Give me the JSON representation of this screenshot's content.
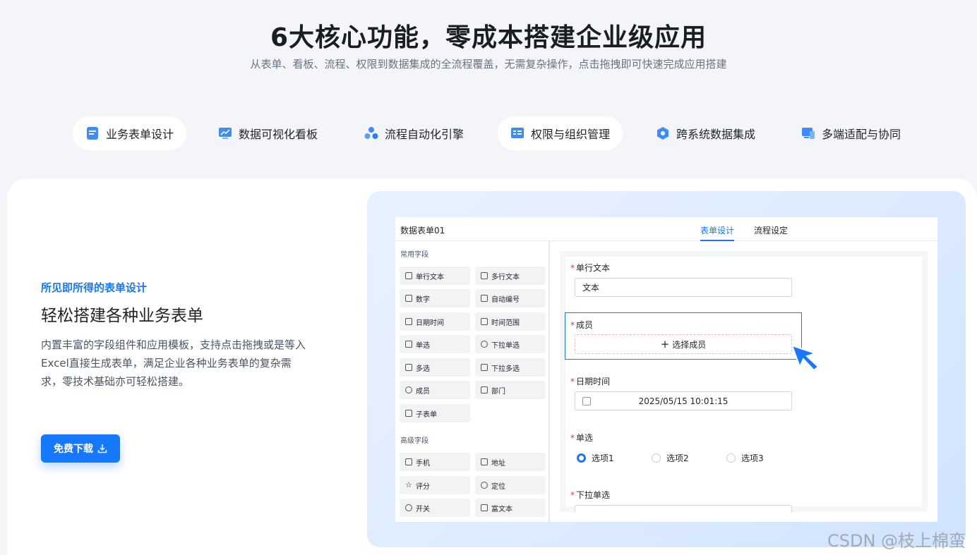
{
  "hero": {
    "title": "6大核心功能，零成本搭建企业级应用",
    "subtitle": "从表单、看板、流程、权限到数据集成的全流程覆盖，无需复杂操作，点击拖拽即可快速完成应用搭建"
  },
  "tabs": [
    {
      "label": "业务表单设计",
      "icon": "form-icon"
    },
    {
      "label": "数据可视化看板",
      "icon": "chart-icon"
    },
    {
      "label": "流程自动化引擎",
      "icon": "flow-icon"
    },
    {
      "label": "权限与组织管理",
      "icon": "permission-icon"
    },
    {
      "label": "跨系统数据集成",
      "icon": "integration-icon"
    },
    {
      "label": "多端适配与协同",
      "icon": "multi-device-icon"
    }
  ],
  "feature": {
    "kicker": "所见即所得的表单设计",
    "title": "轻松搭建各种业务表单",
    "desc": "内置丰富的字段组件和应用模板，支持点击拖拽或是等入Excel直接生成表单，满足企业各种业务表单的复杂需求，零技术基础亦可轻松搭建。",
    "button": "免费下载"
  },
  "app": {
    "title": "数据表单01",
    "tabs": [
      "表单设计",
      "流程设定"
    ],
    "common_label": "常用字段",
    "advanced_label": "高级字段",
    "common_fields": [
      "单行文本",
      "多行文本",
      "数字",
      "自动编号",
      "日期时间",
      "时间范围",
      "单选",
      "下拉单选",
      "多选",
      "下拉多选",
      "成员",
      "部门",
      "子表单"
    ],
    "advanced_fields": [
      "手机",
      "地址",
      "评分",
      "定位",
      "开关",
      "富文本"
    ],
    "form": {
      "text_label": "单行文本",
      "text_value": "文本",
      "member_label": "成员",
      "member_button": "选择成员",
      "date_label": "日期时间",
      "date_value": "2025/05/15  10:01:15",
      "radio_label": "单选",
      "radio_options": [
        "选项1",
        "选项2",
        "选项3"
      ],
      "dropdown_label": "下拉单选"
    }
  },
  "watermark": "CSDN @枝上棉蛮",
  "colors": {
    "accent": "#1677ff",
    "required": "#e53935"
  }
}
